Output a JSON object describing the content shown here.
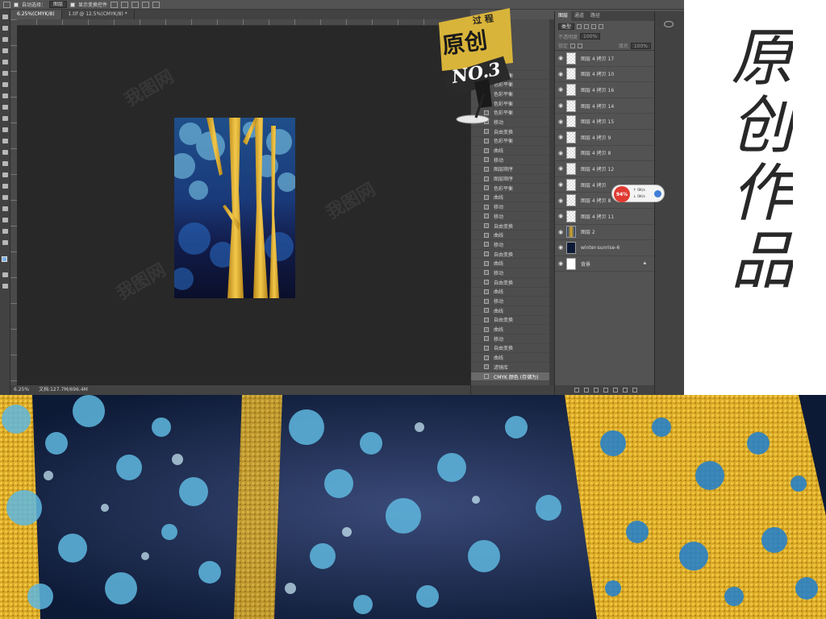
{
  "photoshop": {
    "options_bar": {
      "auto_select_label": "自动选择：",
      "auto_select_target": "图层",
      "show_transform_label": "显示变换控件"
    },
    "tabs": [
      {
        "label": "6.25%(CMYK/8)",
        "active": true
      },
      {
        "label": "1.tif @ 12.5%(CMYK/8) *",
        "active": false
      }
    ],
    "status": {
      "zoom": "6.25%",
      "doc_size": "文档:127.7M/696.4M"
    },
    "history": {
      "items": [
        "图层",
        "色彩平衡",
        "色彩平衡",
        "色彩平衡",
        "色彩平衡",
        "色彩平衡",
        "移动",
        "自由变换",
        "色彩平衡",
        "曲线",
        "移动",
        "图层顺序",
        "图层顺序",
        "色彩平衡",
        "曲线",
        "移动",
        "移动",
        "自由变换",
        "曲线",
        "移动",
        "自由变换",
        "曲线",
        "移动",
        "自由变换",
        "曲线",
        "移动",
        "曲线",
        "自由变换",
        "曲线",
        "移动",
        "自由变换",
        "曲线",
        "滤镜库",
        "CMYK 颜色 (存储为)"
      ],
      "current_index": 33
    },
    "layers": {
      "tabs": [
        {
          "label": "图层",
          "active": true
        },
        {
          "label": "通道",
          "active": false
        },
        {
          "label": "路径",
          "active": false
        }
      ],
      "filter_kind": "类型",
      "mode": "不透明度",
      "opacity": "100%",
      "lock_label": "锁定",
      "fill_label": "填充",
      "fill": "100%",
      "items": [
        {
          "name": "图层 4 拷贝 17",
          "thumb": "transparent"
        },
        {
          "name": "图层 4 拷贝 10",
          "thumb": "transparent"
        },
        {
          "name": "图层 4 拷贝 16",
          "thumb": "transparent"
        },
        {
          "name": "图层 4 拷贝 14",
          "thumb": "transparent"
        },
        {
          "name": "图层 4 拷贝 15",
          "thumb": "transparent"
        },
        {
          "name": "图层 4 拷贝 9",
          "thumb": "transparent"
        },
        {
          "name": "图层 4 拷贝 8",
          "thumb": "transparent"
        },
        {
          "name": "图层 4 拷贝 12",
          "thumb": "transparent"
        },
        {
          "name": "图层 4 拷贝",
          "thumb": "transparent"
        },
        {
          "name": "图层 4 拷贝 8",
          "thumb": "transparent"
        },
        {
          "name": "图层 4 拷贝 11",
          "thumb": "transparent"
        },
        {
          "name": "图层 2",
          "thumb": "art"
        },
        {
          "name": "winter-sunrise-6",
          "thumb": "dark"
        },
        {
          "name": "背景",
          "thumb": "white",
          "locked": true
        }
      ]
    },
    "progress_popup": {
      "percent": "94%",
      "up": "0K/s",
      "down": "0K/s"
    }
  },
  "badge": {
    "top_text": "过 程",
    "main_text": "原创",
    "number": "NO.3"
  },
  "calligraphy": {
    "text": "原创作品"
  },
  "colors": {
    "ps_bg": "#535353",
    "canvas": "#282828",
    "gold": "#d9a928",
    "navy": "#10213f",
    "cyan": "#6cc6e6"
  }
}
